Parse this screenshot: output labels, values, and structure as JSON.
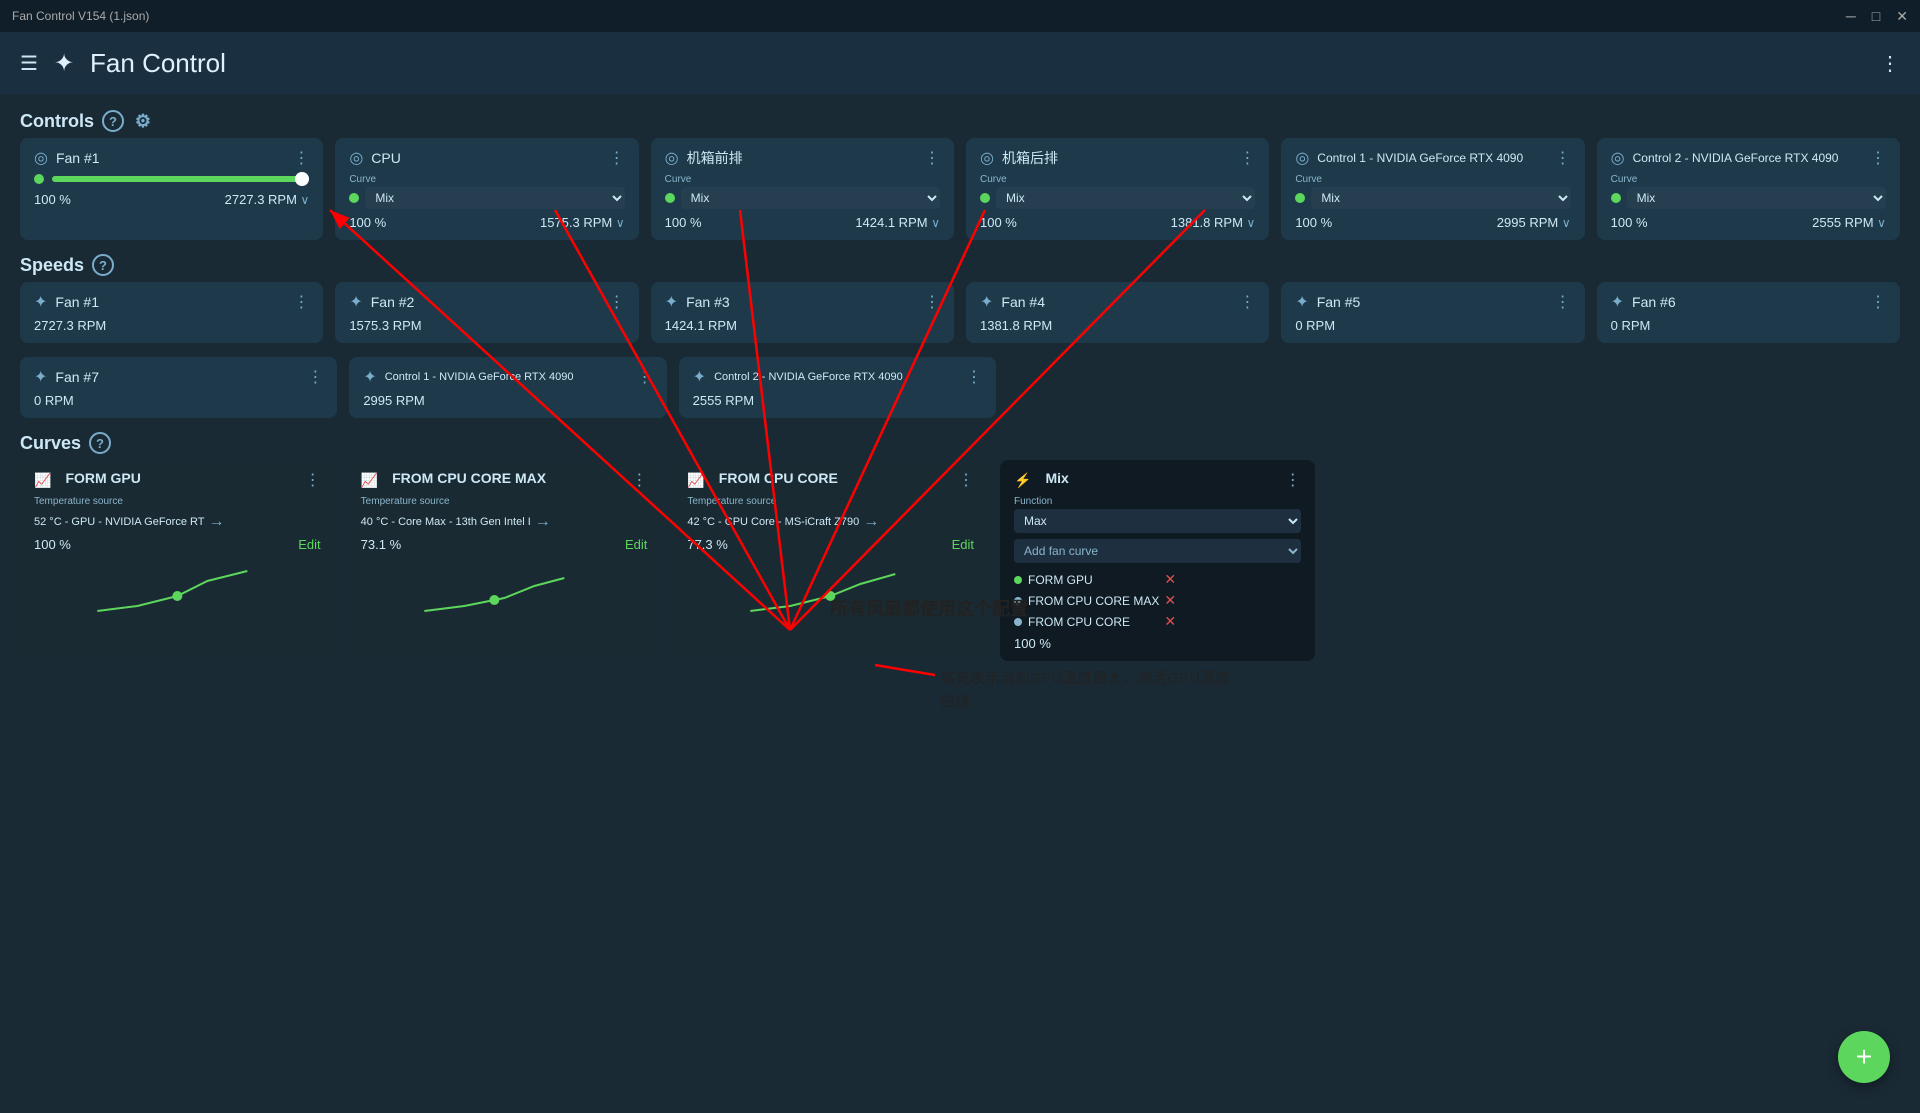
{
  "titleBar": {
    "title": "Fan Control V154 (1.json)",
    "minimize": "─",
    "maximize": "□",
    "close": "✕"
  },
  "header": {
    "title": "Fan Control",
    "moreIcon": "⋮"
  },
  "sections": {
    "controls": "Controls",
    "speeds": "Speeds",
    "curves": "Curves"
  },
  "controls": [
    {
      "id": "fan1",
      "title": "Fan #1",
      "curveLabel": "",
      "curve": null,
      "percent": "100 %",
      "rpm": "2727.3 RPM",
      "hasSlider": true,
      "sliderValue": 100
    },
    {
      "id": "cpu",
      "title": "CPU",
      "curveLabel": "Curve",
      "curve": "Mix",
      "percent": "100 %",
      "rpm": "1575.3 RPM"
    },
    {
      "id": "front",
      "title": "机箱前排",
      "curveLabel": "Curve",
      "curve": "Mix",
      "percent": "100 %",
      "rpm": "1424.1 RPM"
    },
    {
      "id": "rear",
      "title": "机箱后排",
      "curveLabel": "Curve",
      "curve": "Mix",
      "percent": "100 %",
      "rpm": "1381.8 RPM"
    },
    {
      "id": "ctrl1",
      "title": "Control 1 - NVIDIA GeForce RTX 4090",
      "curveLabel": "Curve",
      "curve": "Mix",
      "percent": "100 %",
      "rpm": "2995 RPM"
    },
    {
      "id": "ctrl2",
      "title": "Control 2 - NVIDIA GeForce RTX 4090",
      "curveLabel": "Curve",
      "curve": "Mix",
      "percent": "100 %",
      "rpm": "2555 RPM"
    }
  ],
  "speeds": [
    {
      "id": "s1",
      "title": "Fan #1",
      "rpm": "2727.3 RPM"
    },
    {
      "id": "s2",
      "title": "Fan #2",
      "rpm": "1575.3 RPM"
    },
    {
      "id": "s3",
      "title": "Fan #3",
      "rpm": "1424.1 RPM"
    },
    {
      "id": "s4",
      "title": "Fan #4",
      "rpm": "1381.8 RPM"
    },
    {
      "id": "s5",
      "title": "Fan #5",
      "rpm": "0 RPM"
    },
    {
      "id": "s6",
      "title": "Fan #6",
      "rpm": "0 RPM"
    },
    {
      "id": "s7",
      "title": "Fan #7",
      "rpm": "0 RPM"
    },
    {
      "id": "s8",
      "title": "Control 1 - NVIDIA GeForce RTX 4090",
      "rpm": "2995 RPM"
    },
    {
      "id": "s9",
      "title": "Control 2 - NVIDIA GeForce RTX 4090",
      "rpm": "2555 RPM"
    }
  ],
  "curves": [
    {
      "id": "c1",
      "title": "FORM GPU",
      "tempSource": "52 °C - GPU - NVIDIA GeForce RT→",
      "percent": "100 %",
      "editLabel": "Edit",
      "chartPoints": "10,55 30,45 50,35 70,20 80,15"
    },
    {
      "id": "c2",
      "title": "FROM CPU CORE MAX",
      "tempSource": "40 °C - Core Max - 13th Gen Intel I→",
      "percent": "73.1 %",
      "editLabel": "Edit",
      "chartPoints": "10,55 30,48 50,40 60,30 70,22"
    },
    {
      "id": "c3",
      "title": "FROM CPU CORE",
      "tempSource": "42 °C - CPU Core - MS-iCraft Z790→",
      "percent": "77.3 %",
      "editLabel": "Edit",
      "chartPoints": "10,55 30,48 50,38 60,28 70,20"
    },
    {
      "id": "c4",
      "title": "Mix",
      "functionLabel": "Function",
      "function": "Max",
      "addFanCurve": "Add fan curve",
      "curveList": [
        {
          "name": "FORM GPU",
          "active": true
        },
        {
          "name": "FROM CPU CORE MAX",
          "active": false
        },
        {
          "name": "FROM CPU CORE",
          "active": false
        }
      ],
      "percent": "100 %"
    }
  ],
  "annotations": {
    "allFans": "所有风扇都使用这个配置",
    "highlight": "高亮表示当前GPU温度最大，激活GPU温度\n曲线"
  },
  "fab": "+"
}
